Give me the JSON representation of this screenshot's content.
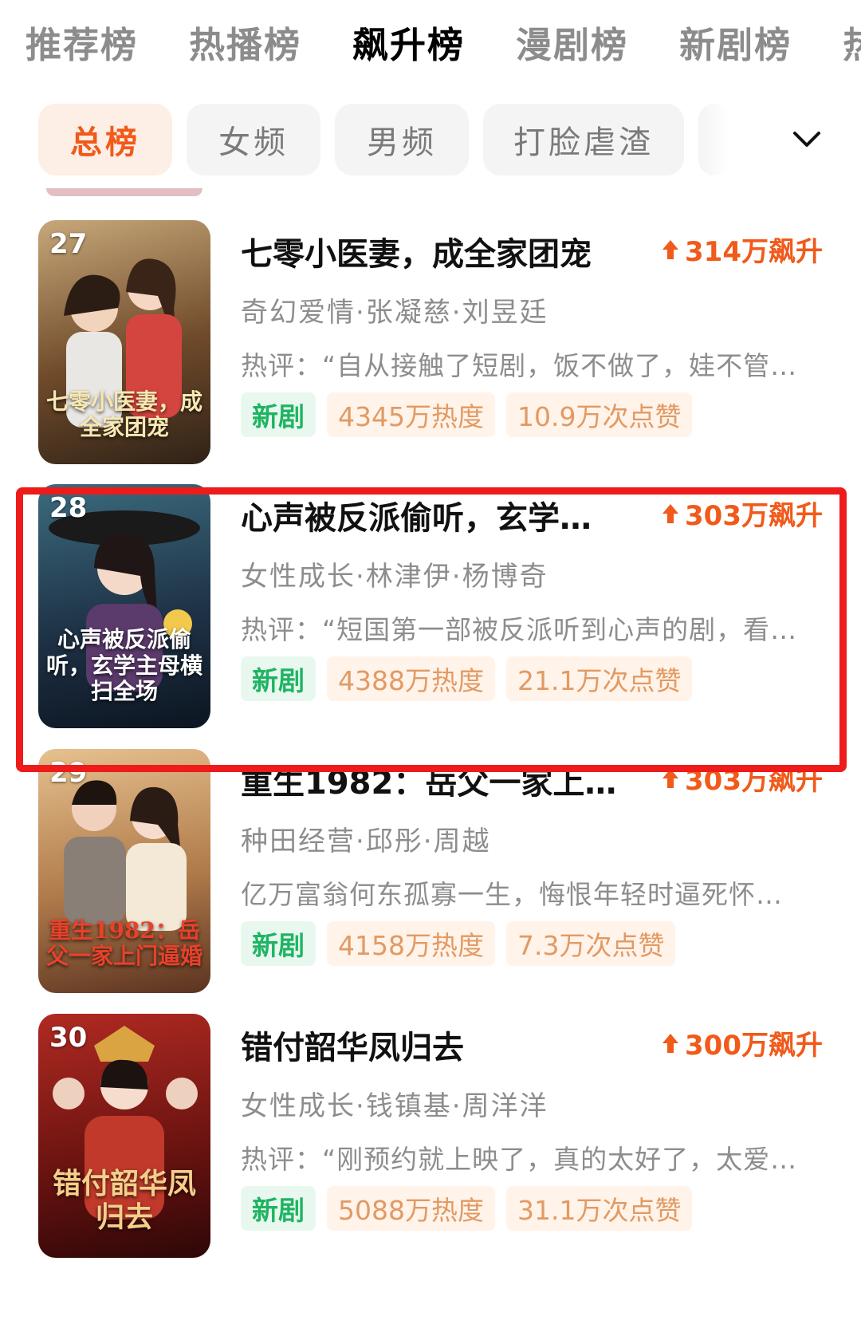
{
  "tabs": [
    "推荐榜",
    "热播榜",
    "飙升榜",
    "漫剧榜",
    "新剧榜",
    "热"
  ],
  "active_tab_index": 2,
  "filters": [
    "总榜",
    "女频",
    "男频",
    "打脸虐渣"
  ],
  "active_filter_index": 0,
  "items": [
    {
      "rank": "27",
      "title": "七零小医妻，成全家团宠",
      "rise": "314万飙升",
      "meta": "奇幻爱情·张凝慈·刘昱廷",
      "comment": "热评：“自从接触了短剧，饭不做了，娃不管…",
      "tag": "新剧",
      "heat": "4345万热度",
      "likes": "10.9万次点赞",
      "poster_text": "七零小医妻，成全家团宠",
      "poster_colors": [
        "#c7a87a",
        "#6f4a2a",
        "#2f2217"
      ],
      "poster_text_color": "#f7e7b2"
    },
    {
      "rank": "28",
      "title": "心声被反派偷听，玄学…",
      "rise": "303万飙升",
      "meta": "女性成长·林津伊·杨博奇",
      "comment": "热评：“短国第一部被反派听到心声的剧，看…",
      "tag": "新剧",
      "heat": "4388万热度",
      "likes": "21.1万次点赞",
      "poster_text": "心声被反派偷听，玄学主母横扫全场",
      "poster_colors": [
        "#3c6b7e",
        "#1f3347",
        "#0c1521"
      ],
      "poster_text_color": "#ffffff"
    },
    {
      "rank": "29",
      "title": "重生1982：岳父一家上…",
      "rise": "303万飙升",
      "meta": "种田经营·邱彤·周越",
      "comment": "亿万富翁何东孤寡一生，悔恨年轻时逼死怀…",
      "tag": "新剧",
      "heat": "4158万热度",
      "likes": "7.3万次点赞",
      "poster_text": "重生1982：岳父一家上门逼婚",
      "poster_colors": [
        "#e6c18e",
        "#b07a4a",
        "#5a3320"
      ],
      "poster_text_color": "#e8412b"
    },
    {
      "rank": "30",
      "title": "错付韶华凤归去",
      "rise": "300万飙升",
      "meta": "女性成长·钱镇基·周洋洋",
      "comment": "热评：“刚预约就上映了，真的太好了，太爱…",
      "tag": "新剧",
      "heat": "5088万热度",
      "likes": "31.1万次点赞",
      "poster_text": "错付韶华凤归去",
      "poster_colors": [
        "#b02a22",
        "#6e1411",
        "#2e0707"
      ],
      "poster_text_color": "#f3cf8a"
    }
  ]
}
